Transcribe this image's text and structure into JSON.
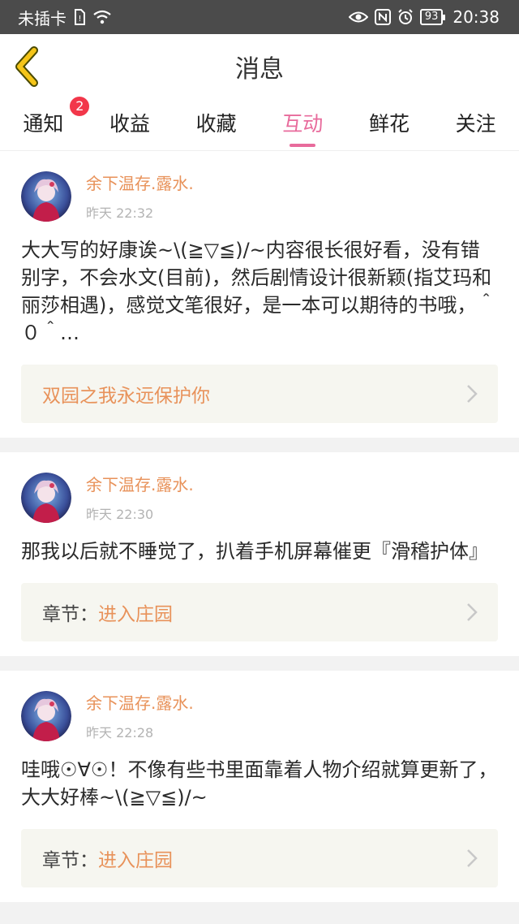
{
  "status_bar": {
    "carrier": "未插卡",
    "battery": "93",
    "time": "20:38"
  },
  "header": {
    "title": "消息"
  },
  "tabs": [
    {
      "label": "通知",
      "badge": "2"
    },
    {
      "label": "收益"
    },
    {
      "label": "收藏"
    },
    {
      "label": "互动"
    },
    {
      "label": "鲜花"
    },
    {
      "label": "关注"
    }
  ],
  "active_tab": "互动",
  "messages": [
    {
      "username": "余下温存.露水.",
      "time": "昨天 22:32",
      "text": "大大写的好康诶~\\(≧▽≦)/~内容很长很好看，没有错别字，不会水文(目前)，然后剧情设计很新颖(指艾玛和丽莎相遇)，感觉文笔很好，是一本可以期待的书哦，＾０＾…",
      "ref_title": "双园之我永远保护你"
    },
    {
      "username": "余下温存.露水.",
      "time": "昨天 22:30",
      "text": "那我以后就不睡觉了，扒着手机屏幕催更『滑稽护体』",
      "ref_label": "章节：",
      "ref_chapter": "进入庄园"
    },
    {
      "username": "余下温存.露水.",
      "time": "昨天 22:28",
      "text": "哇哦☉∀☉！不像有些书里面靠着人物介绍就算更新了，大大好棒~\\(≧▽≦)/~",
      "ref_label": "章节：",
      "ref_chapter": "进入庄园"
    }
  ],
  "colors": {
    "accent_pink": "#e86b9c",
    "accent_orange": "#e8925a",
    "back_arrow": "#f5c518",
    "badge_red": "#f2374a"
  }
}
